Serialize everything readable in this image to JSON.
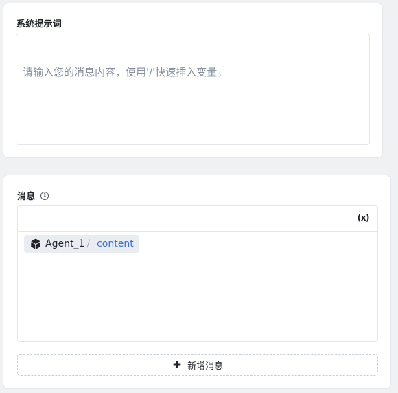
{
  "system_prompt": {
    "title": "系统提示词",
    "placeholder": "请输入您的消息内容，使用'/'快速插入变量。"
  },
  "message": {
    "title": "消息",
    "info_icon": "info-circle-icon",
    "variable_icon_glyph": "(x)",
    "chip": {
      "icon": "cube-icon",
      "agent": "Agent_1",
      "separator": "/",
      "variable": "content"
    },
    "add_label": "新增消息",
    "add_icon": "plus-icon"
  },
  "colors": {
    "background": "#f0f1f3",
    "card": "#ffffff",
    "border": "#e4e6eb",
    "placeholder": "#86909c",
    "variable_link": "#3b6fd6",
    "chip_bg": "#e9ecf1"
  }
}
